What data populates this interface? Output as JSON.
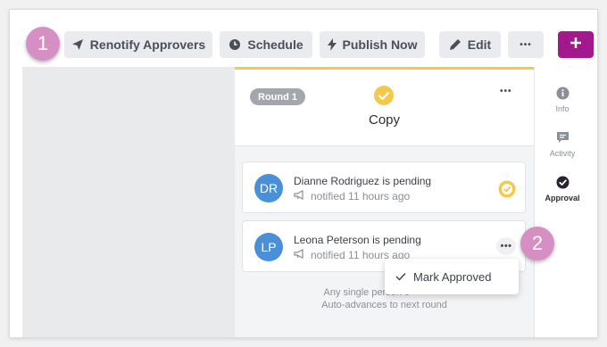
{
  "toolbar": {
    "renotify_label": "Renotify Approvers",
    "schedule_label": "Schedule",
    "publish_label": "Publish Now",
    "edit_label": "Edit",
    "more_label": "•••"
  },
  "callouts": {
    "first": "1",
    "second": "2"
  },
  "round": {
    "badge": "Round 1",
    "stage": "Copy",
    "more_label": "•••"
  },
  "approvers": [
    {
      "initials": "DR",
      "name": "Dianne Rodriguez is pending",
      "note": "notified 11 hours ago",
      "status": "approved-check"
    },
    {
      "initials": "LP",
      "name": "Leona Peterson is pending",
      "note": "notified 11 hours ago",
      "more_label": "•••"
    }
  ],
  "context_menu": {
    "item": "Mark Approved"
  },
  "footer": {
    "line1": "Any single person c",
    "line2": "Auto-advances to next round"
  },
  "sidebar": {
    "items": [
      {
        "label": "Info",
        "icon": "info-icon"
      },
      {
        "label": "Activity",
        "icon": "activity-icon"
      },
      {
        "label": "Approval",
        "icon": "approval-icon",
        "active": true
      }
    ]
  },
  "colors": {
    "accent": "#a3188c",
    "callout": "#d68fc3",
    "check": "#f2c94c",
    "avatar": "#4a90d9"
  }
}
